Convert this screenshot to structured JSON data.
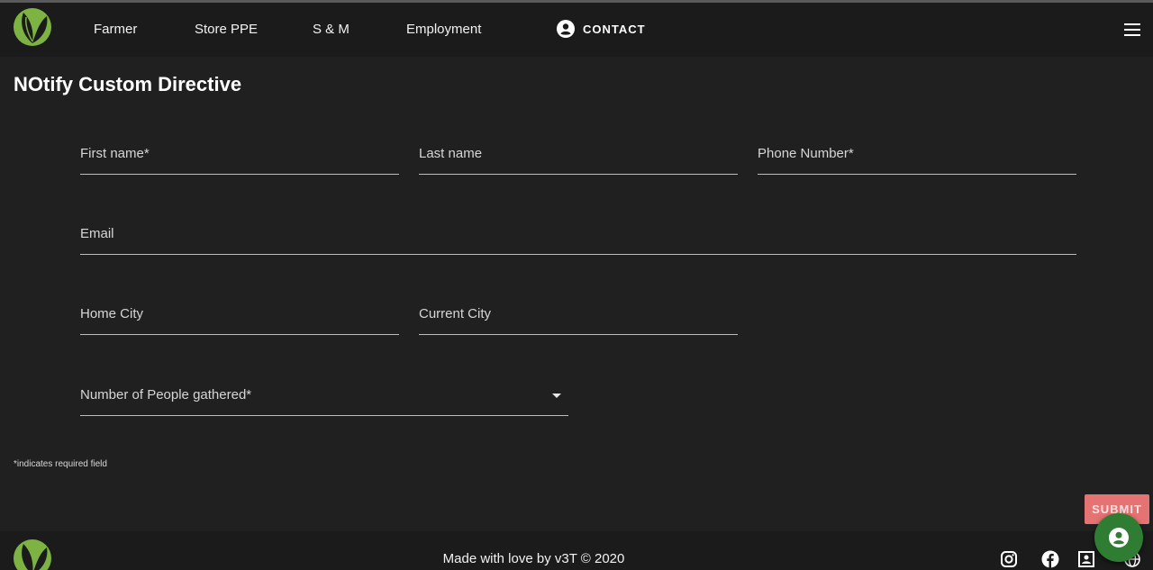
{
  "nav": {
    "logo_icon": "leaf-logo-icon",
    "links": [
      "Farmer",
      "Store PPE",
      "S & M",
      "Employment"
    ],
    "contact_label": "CONTACT",
    "contact_icon": "account-circle-icon",
    "menu_icon": "hamburger-menu-icon"
  },
  "page": {
    "title": "NOtify Custom Directive"
  },
  "form": {
    "first_name": "First name*",
    "last_name": "Last name",
    "phone": "Phone Number*",
    "email": "Email",
    "home_city": "Home City",
    "current_city": "Current City",
    "people": "Number of People gathered*",
    "required_note": "*indicates required field",
    "submit_label": "SUBMIT"
  },
  "footer": {
    "text": "Made with love by v3T © 2020",
    "icons": [
      "instagram-icon",
      "facebook-icon",
      "contact-card-icon",
      "globe-icon"
    ]
  },
  "fab": {
    "icon": "account-circle-icon"
  },
  "colors": {
    "background": "#202020",
    "bar": "#1b1b1b",
    "submit": "#e57373",
    "fab": "#2e7d32",
    "logo_green": "#7cb342"
  }
}
